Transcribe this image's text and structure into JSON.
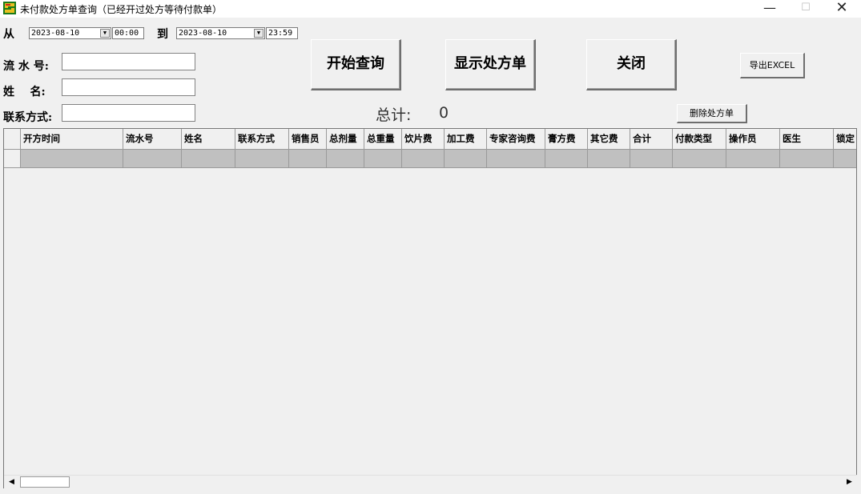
{
  "window": {
    "title": "未付款处方单查询（已经开过处方等待付款单）",
    "minimize": "—",
    "maximize": "☐",
    "close": "✕"
  },
  "filters": {
    "from_label": "从",
    "from_date": "2023-08-10",
    "from_time": "00:00",
    "to_label": "到",
    "to_date": "2023-08-10",
    "to_time": "23:59",
    "serial_label": "流 水 号:",
    "serial_value": "",
    "name_label": "姓    名:",
    "name_value": "",
    "contact_label": "联系方式:",
    "contact_value": ""
  },
  "buttons": {
    "search": "开始查询",
    "show": "显示处方单",
    "close": "关闭",
    "export": "导出EXCEL",
    "delete": "删除处方单"
  },
  "summary": {
    "total_label": "总计:",
    "total_value": "0"
  },
  "grid": {
    "columns": [
      "开方时间",
      "流水号",
      "姓名",
      "联系方式",
      "销售员",
      "总剂量",
      "总重量",
      "饮片费",
      "加工费",
      "专家咨询费",
      "膏方费",
      "其它费",
      "合计",
      "付款类型",
      "操作员",
      "医生",
      "锁定"
    ]
  },
  "colors": {
    "background": "#f0f0f0",
    "row_fill": "#c0c0c0"
  },
  "icons": {
    "app": "app-icon",
    "dropdown": "chevron-down-icon",
    "scroll_left": "arrow-left-icon",
    "scroll_right": "arrow-right-icon"
  }
}
